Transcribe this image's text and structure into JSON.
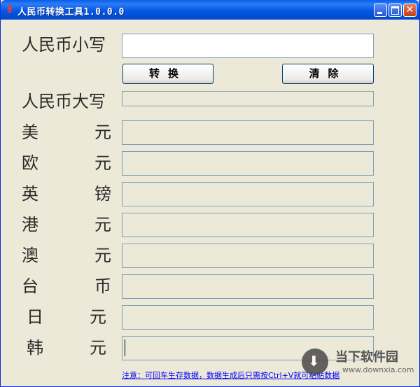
{
  "window": {
    "title": "人民币转换工具1.0.0.0",
    "app_icon": "¥",
    "controls": {
      "minimize": "minimize-icon",
      "maximize": "maximize-icon",
      "close": "close-icon",
      "close_glyph": "✕"
    }
  },
  "form": {
    "lowercase_label": "人民币小写",
    "lowercase_value": "",
    "convert_button": "转换",
    "clear_button": "清除",
    "uppercase_label": "人民币大写",
    "uppercase_value": ""
  },
  "currencies": [
    {
      "left": "美",
      "right": "元",
      "value": ""
    },
    {
      "left": "欧",
      "right": "元",
      "value": ""
    },
    {
      "left": "英",
      "right": "镑",
      "value": ""
    },
    {
      "left": "港",
      "right": "元",
      "value": ""
    },
    {
      "left": "澳",
      "right": "元",
      "value": ""
    },
    {
      "left": "台",
      "right": "币",
      "value": ""
    },
    {
      "left": "日",
      "right": "元",
      "value": ""
    },
    {
      "left": "韩",
      "right": "元",
      "value": ""
    }
  ],
  "note": "注意：可回车生存数据，数据生成后只需按Ctrl+V就可粘贴数据",
  "watermark": {
    "name": "当下软件园",
    "domain": "www.downxia.com",
    "icon": "download-arrow-icon",
    "arrow_glyph": "⬇"
  },
  "colors": {
    "titlebar": "#0558e4",
    "window_bg": "#ece9d8",
    "field_border": "#7f9db9",
    "link": "#0000ff"
  }
}
